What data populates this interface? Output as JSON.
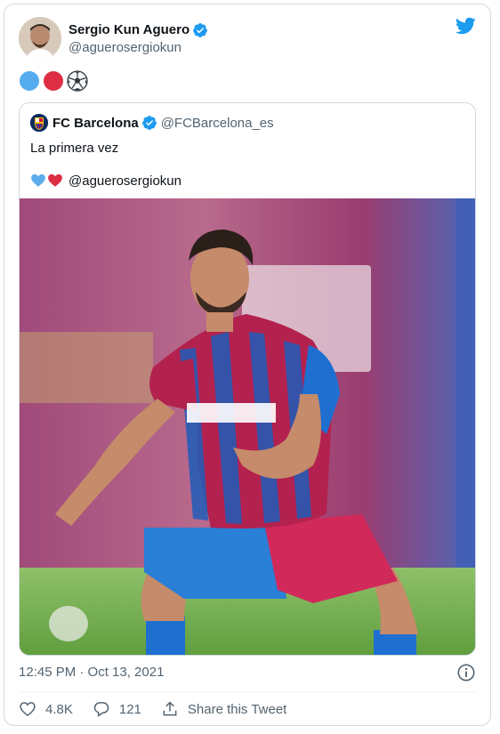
{
  "tweet": {
    "author_name": "Sergio Kun Aguero",
    "author_handle": "@aguerosergiokun",
    "emojis": [
      "blue-circle",
      "red-circle",
      "soccer-ball"
    ],
    "timestamp": "12:45 PM · Oct 13, 2021",
    "likes": "4.8K",
    "replies": "121",
    "share_label": "Share this Tweet"
  },
  "quoted": {
    "name": "FC Barcelona",
    "handle": "@FCBarcelona_es",
    "text": "La primera vez",
    "hearts": [
      "blue-heart",
      "red-heart"
    ],
    "mention": "@aguerosergiokun"
  },
  "colors": {
    "twitter_blue": "#1d9bf0",
    "text_secondary": "#536471",
    "border": "#cfd9de"
  }
}
